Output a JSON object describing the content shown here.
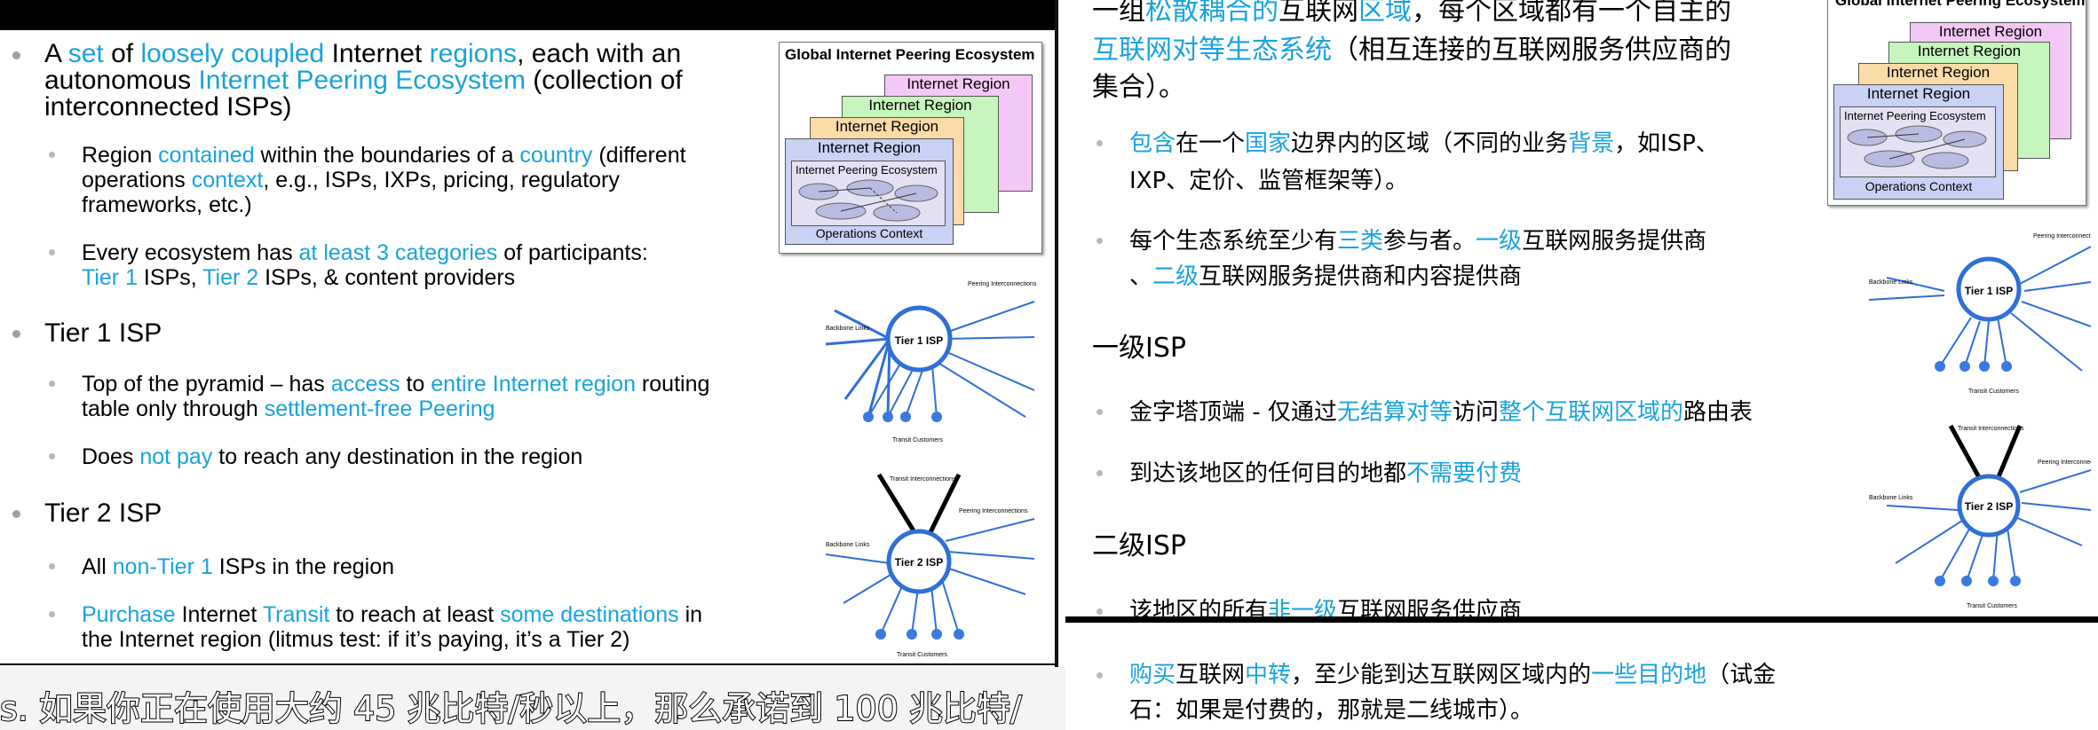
{
  "left_slide": {
    "bullets": [
      {
        "parts": [
          "A ",
          "set",
          " of ",
          "loosely coupled",
          " Internet ",
          "regions",
          ", each with an"
        ]
      },
      {
        "parts": [
          "autonomous ",
          "Internet Peering Ecosystem",
          " (collection of"
        ]
      },
      {
        "parts": [
          "interconnected ISPs)"
        ]
      }
    ],
    "sub1_lines": [
      [
        "Region ",
        "contained",
        " within the boundaries of a ",
        "country",
        " (different"
      ],
      [
        "operations ",
        "context",
        ", e.g., ISPs, IXPs, pricing, regulatory"
      ],
      [
        "frameworks, etc.)"
      ]
    ],
    "sub2_lines": [
      [
        "Every ecosystem has ",
        "at least 3 categories",
        " of participants:"
      ],
      [
        "Tier 1",
        " ISPs, ",
        "Tier 2",
        " ISPs, & content providers"
      ]
    ],
    "tier1_heading": "Tier 1 ISP",
    "tier1_sub1_lines": [
      [
        "Top of the pyramid – has ",
        "access",
        " to ",
        "entire Internet region",
        " routing"
      ],
      [
        "table only through ",
        "settlement-free Peering"
      ]
    ],
    "tier1_sub2": [
      "Does ",
      "not pay",
      " to reach any destination in the region"
    ],
    "tier2_heading": "Tier 2 ISP",
    "tier2_sub1": [
      "All ",
      "non-Tier 1",
      " ISPs in the region"
    ],
    "tier2_sub2_lines": [
      [
        "Purchase",
        " Internet ",
        "Transit",
        " to reach at least ",
        "some destinations",
        " in"
      ],
      [
        "the Internet region (litmus test: if it’s paying, it’s a Tier 2)"
      ]
    ]
  },
  "figures": {
    "ecosystem_title": "Global Internet Peering Ecosystem",
    "region_label": "Internet Region",
    "ecosystem_label": "Internet Peering Ecosystem",
    "ops_label": "Operations Context",
    "tier1_label": "Tier 1 ISP",
    "tier2_label": "Tier 2 ISP",
    "peering_label": "Peering Interconnections",
    "backbone_label": "Backbone Links",
    "transit_customers_label": "Transit Customers",
    "transit_interconnections_label": "Transit Interconnections"
  },
  "right_window": {
    "intro_lines": [
      [
        "一组",
        "松散耦合的",
        "互联网",
        "区域",
        "，每个区域都有一个自主的"
      ],
      [
        "互联网对等生态系统",
        "（相互连接的互联网服务供应商的"
      ],
      [
        "集合）。"
      ]
    ],
    "cn_sub1_lines": [
      [
        "包含",
        "在一个",
        "国家",
        "边界内的区域（不同的业务",
        "背景",
        "，如ISP、"
      ],
      [
        "IXP、定价、监管框架等）。"
      ]
    ],
    "cn_sub2_lines": [
      [
        "每个生态系统至少有",
        "三类",
        "参与者。",
        "一级",
        "互联网服务提供商"
      ],
      [
        "、",
        "二级",
        "互联网服务提供商和内容提供商"
      ]
    ],
    "tier1_heading": "一级ISP",
    "tier1_sub1": [
      "金字塔顶端 - 仅通过",
      "无结算对等",
      "访问",
      "整个互联网区域的",
      "路由表"
    ],
    "tier1_sub2": [
      "到达该地区的任何目的地都",
      "不需要付费"
    ],
    "tier2_heading": "二级ISP",
    "tier2_sub1": [
      "该地区的所有",
      "非一级",
      "互联网服务供应商"
    ],
    "tier2_sub2_lines": [
      [
        "购买",
        "互联网",
        "中转",
        "，至少能到达互联网区域内的",
        "一些目的地",
        "（试金"
      ],
      [
        "石：如果是付费的，那就是二线城市）。"
      ]
    ]
  },
  "subtitle_text": "s. 如果你正在使用大约 45 兆比特/秒以上，那么承诺到 100 兆比特/",
  "colors": {
    "highlight": "#19a3dd",
    "bullet": "#9aa0a6"
  }
}
